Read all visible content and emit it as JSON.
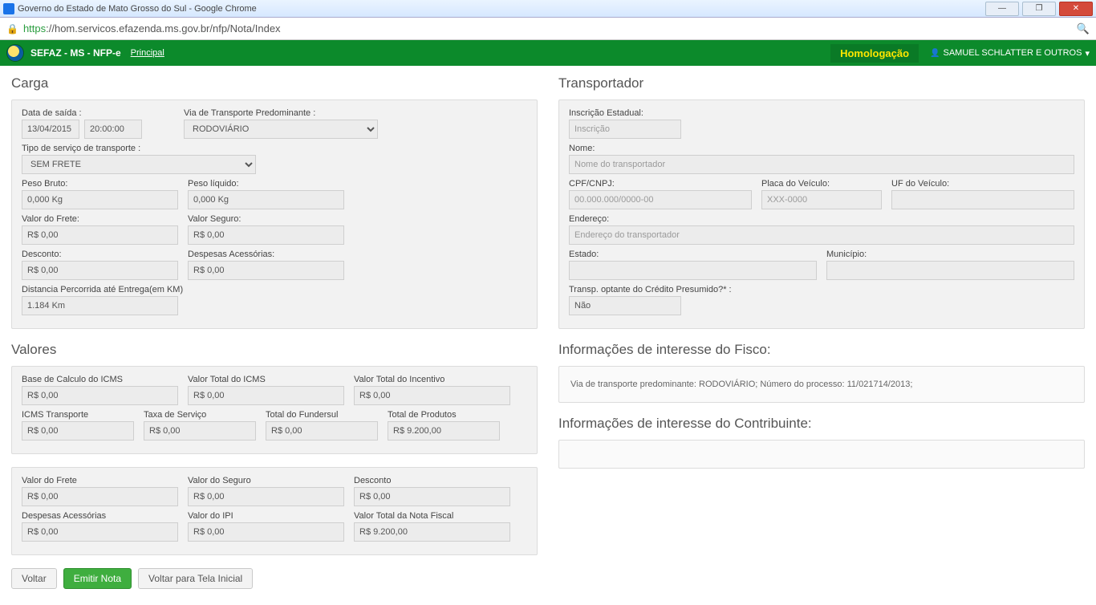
{
  "window": {
    "title": "Governo do Estado de Mato Grosso do Sul - Google Chrome",
    "url_scheme": "https",
    "url_rest": "://hom.servicos.efazenda.ms.gov.br/nfp/Nota/Index"
  },
  "header": {
    "brand": "SEFAZ - MS - NFP-e",
    "nav_principal": "Principal",
    "homolog": "Homologação",
    "user": "SAMUEL SCHLATTER E OUTROS",
    "user_caret": "▾"
  },
  "carga": {
    "title": "Carga",
    "data_saida_label": "Data de saída :",
    "data_saida_date": "13/04/2015",
    "data_saida_time": "20:00:00",
    "via_transp_label": "Via de Transporte Predominante :",
    "via_transp_value": "RODOVIÁRIO",
    "tipo_servico_label": "Tipo de serviço de transporte :",
    "tipo_servico_value": "SEM FRETE",
    "peso_bruto_label": "Peso Bruto:",
    "peso_bruto_value": "0,000 Kg",
    "peso_liquido_label": "Peso líquido:",
    "peso_liquido_value": "0,000 Kg",
    "valor_frete_label": "Valor do Frete:",
    "valor_frete_value": "R$ 0,00",
    "valor_seguro_label": "Valor Seguro:",
    "valor_seguro_value": "R$ 0,00",
    "desconto_label": "Desconto:",
    "desconto_value": "R$ 0,00",
    "despesas_label": "Despesas Acessórias:",
    "despesas_value": "R$ 0,00",
    "distancia_label": "Distancia Percorrida até Entrega(em KM)",
    "distancia_value": "1.184 Km"
  },
  "valores": {
    "title": "Valores",
    "panel1": {
      "base_icms_label": "Base de Calculo do ICMS",
      "base_icms_value": "R$ 0,00",
      "total_icms_label": "Valor Total do ICMS",
      "total_icms_value": "R$ 0,00",
      "total_incentivo_label": "Valor Total do Incentivo",
      "total_incentivo_value": "R$ 0,00",
      "icms_transp_label": "ICMS Transporte",
      "icms_transp_value": "R$ 0,00",
      "taxa_serv_label": "Taxa de Serviço",
      "taxa_serv_value": "R$ 0,00",
      "total_fundersul_label": "Total do Fundersul",
      "total_fundersul_value": "R$ 0,00",
      "total_produtos_label": "Total de Produtos",
      "total_produtos_value": "R$ 9.200,00"
    },
    "panel2": {
      "valor_frete_label": "Valor do Frete",
      "valor_frete_value": "R$ 0,00",
      "valor_seguro_label": "Valor do Seguro",
      "valor_seguro_value": "R$ 0,00",
      "desconto_label": "Desconto",
      "desconto_value": "R$ 0,00",
      "despesas_label": "Despesas Acessórias",
      "despesas_value": "R$ 0,00",
      "valor_ipi_label": "Valor do IPI",
      "valor_ipi_value": "R$ 0,00",
      "valor_nf_label": "Valor Total da Nota Fiscal",
      "valor_nf_value": "R$ 9.200,00"
    }
  },
  "transp": {
    "title": "Transportador",
    "ie_label": "Inscrição Estadual:",
    "ie_placeholder": "Inscrição",
    "nome_label": "Nome:",
    "nome_placeholder": "Nome do transportador",
    "cpf_label": "CPF/CNPJ:",
    "cpf_placeholder": "00.000.000/0000-00",
    "placa_label": "Placa do Veículo:",
    "placa_placeholder": "XXX-0000",
    "uf_label": "UF do Veículo:",
    "endereco_label": "Endereço:",
    "endereco_placeholder": "Endereço do transportador",
    "estado_label": "Estado:",
    "municipio_label": "Município:",
    "credito_label": "Transp. optante do Crédito Presumido?* :",
    "credito_value": "Não"
  },
  "fisco": {
    "title": "Informações de interesse do Fisco:",
    "text": "Via de transporte predominante: RODOVIÁRIO; Número do processo: 11/021714/2013;"
  },
  "contrib": {
    "title": "Informações de interesse do Contribuinte:"
  },
  "buttons": {
    "voltar": "Voltar",
    "emitir": "Emitir Nota",
    "voltar_inicial": "Voltar para Tela Inicial"
  }
}
